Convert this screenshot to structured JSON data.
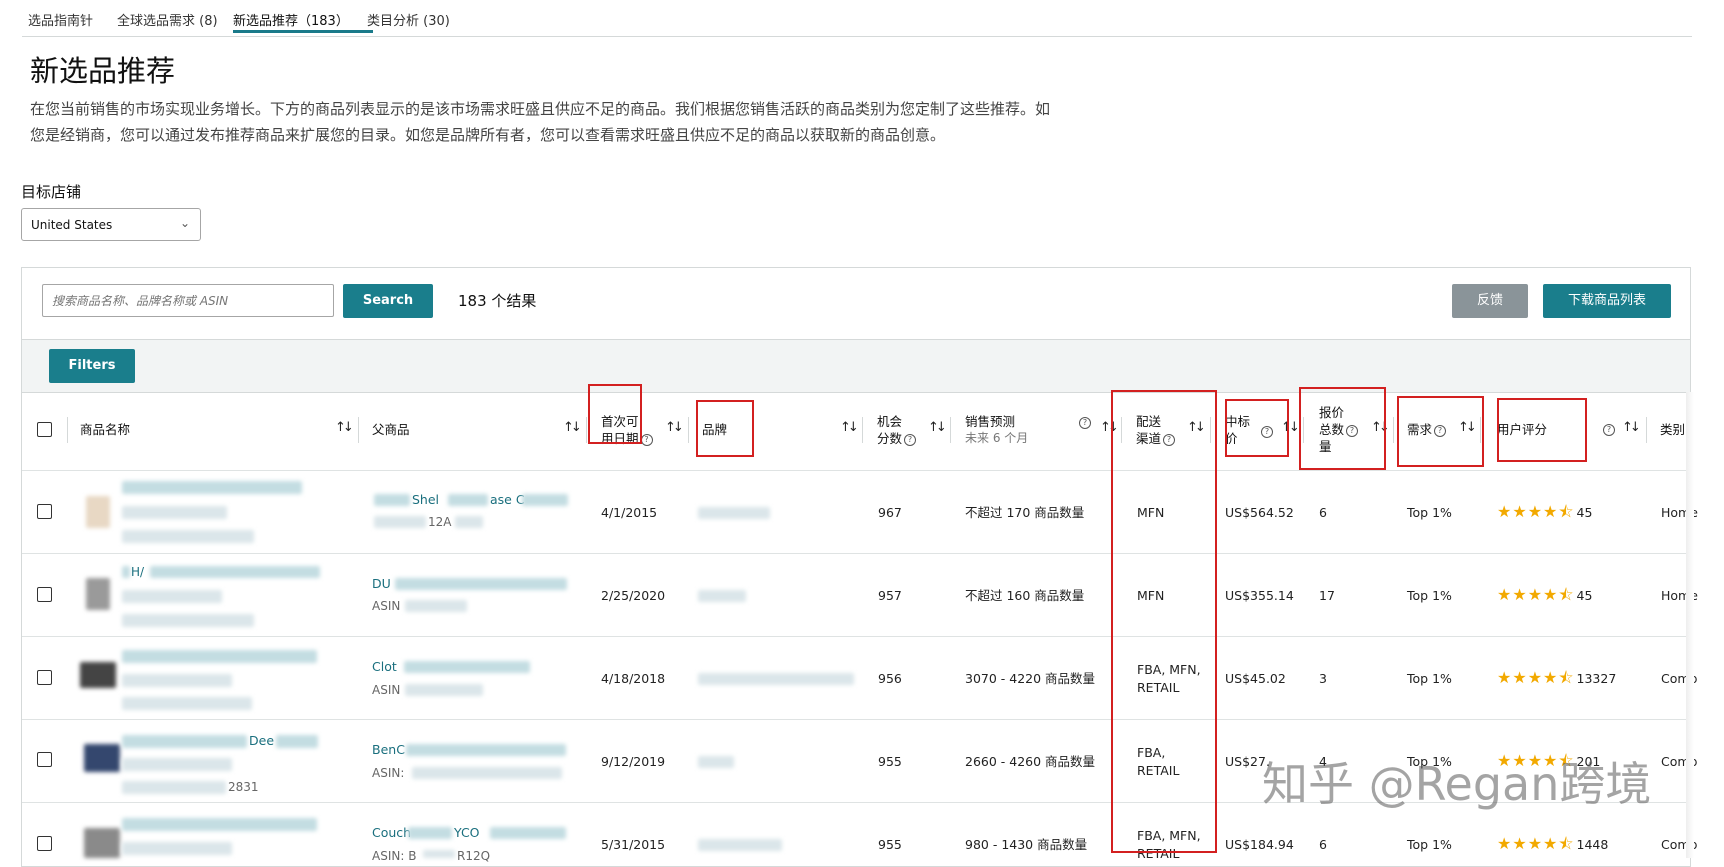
{
  "tabs": [
    {
      "label": "选品指南针"
    },
    {
      "label": "全球选品需求 (8)"
    },
    {
      "label": "新选品推荐（183）",
      "active": true
    },
    {
      "label": "类目分析 (30)"
    }
  ],
  "page_title": "新选品推荐",
  "intro_line1": "在您当前销售的市场实现业务增长。下方的商品列表显示的是该市场需求旺盛且供应不足的商品。我们根据您销售活跃的商品类别为您定制了这些推荐。如",
  "intro_line2": "您是经销商，您可以通过发布推荐商品来扩展您的目录。如您是品牌所有者，您可以查看需求旺盛且供应不足的商品以获取新的商品创意。",
  "store": {
    "label": "目标店铺",
    "value": "United States"
  },
  "search": {
    "placeholder": "搜索商品名称、品牌名称或 ASIN",
    "button": "Search",
    "results": "183 个结果"
  },
  "actions": {
    "feedback": "反馈",
    "download": "下载商品列表",
    "filters": "Filters"
  },
  "columns": {
    "product_name": "商品名称",
    "parent": "父商品",
    "first_date_1": "首次可",
    "first_date_2": "用日期",
    "brand": "品牌",
    "opportunity_1": "机会",
    "opportunity_2": "分数",
    "forecast": "销售预测",
    "forecast_sub": "未来 6 个月",
    "channel_1": "配送",
    "channel_2": "渠道",
    "price_1": "中标",
    "price_2": "价",
    "offers_1": "报价",
    "offers_2": "总数",
    "offers_3": "量",
    "demand": "需求",
    "rating": "用户评分",
    "category": "类别"
  },
  "rows": [
    {
      "parent_text": "Shel",
      "parent_text2": "ase C",
      "parent_asin": "12A",
      "date": "4/1/2015",
      "score": "967",
      "forecast": "不超过 170 商品数量",
      "channel": [
        "MFN"
      ],
      "price": "US$564.52",
      "offers": "6",
      "demand": "Top 1%",
      "rating": 4.5,
      "reviews": "45",
      "category": "Home"
    },
    {
      "parent_text": "DU",
      "parent_asin": "ASIN",
      "name_text": "H/",
      "date": "2/25/2020",
      "score": "957",
      "forecast": "不超过 160 商品数量",
      "channel": [
        "MFN"
      ],
      "price": "US$355.14",
      "offers": "17",
      "demand": "Top 1%",
      "rating": 4.5,
      "reviews": "45",
      "category": "Home"
    },
    {
      "parent_text": "Clot",
      "parent_asin": "ASIN",
      "date": "4/18/2018",
      "score": "956",
      "forecast": "3070 - 4220 商品数量",
      "channel": [
        "FBA, MFN,",
        "RETAIL"
      ],
      "price": "US$45.02",
      "offers": "3",
      "demand": "Top 1%",
      "rating": 4.5,
      "reviews": "13327",
      "category": "Comp"
    },
    {
      "parent_text": "BenC",
      "parent_asin": "ASIN:",
      "name_text": "Dee",
      "name_text2": "2831",
      "date": "9/12/2019",
      "score": "955",
      "forecast": "2660 - 4260 商品数量",
      "channel": [
        "FBA,",
        "RETAIL"
      ],
      "price": "US$27.",
      "offers": "4",
      "demand": "Top 1%",
      "rating": 4.5,
      "reviews": "201",
      "category": "Comp"
    },
    {
      "parent_text": "Couch",
      "parent_text2": "YCO",
      "parent_asin": "ASIN: B",
      "parent_asin2": "R12Q",
      "date": "5/31/2015",
      "score": "955",
      "forecast": "980 - 1430 商品数量",
      "channel": [
        "FBA, MFN,",
        "RETAIL"
      ],
      "price": "US$184.94",
      "offers": "6",
      "demand": "Top 1%",
      "rating": 4.5,
      "reviews": "1448",
      "category": "Comp"
    }
  ],
  "watermark": "知乎 @Regan跨境",
  "colors": {
    "accent": "#1a7e8c",
    "highlight_box": "#d32020",
    "star": "#f2a900"
  }
}
